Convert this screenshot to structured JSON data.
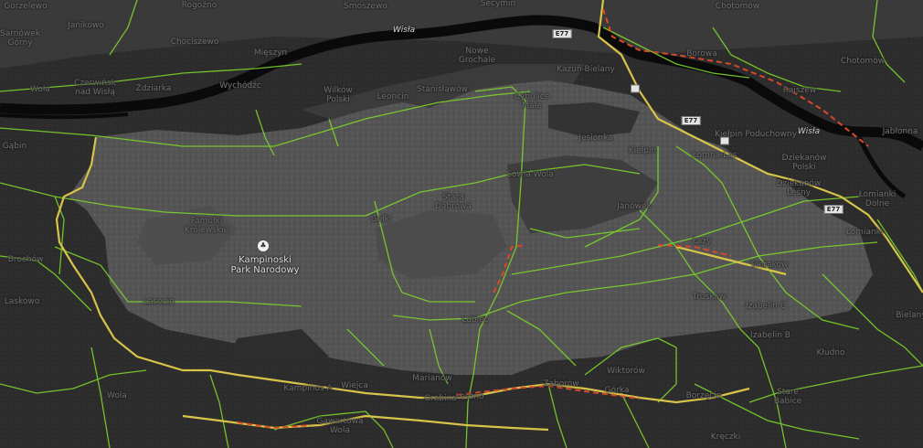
{
  "map": {
    "colors": {
      "background": "#2e2e2e",
      "forest": "#555555",
      "river": "#0b0b0b",
      "road_green": "#7bd32a",
      "road_yellow": "#d8c34a",
      "road_red": "#d9472b"
    },
    "park": {
      "name_line1": "Kampinoski",
      "name_line2": "Park Narodowy",
      "icon": "tree-icon"
    },
    "rivers": [
      "Wisła",
      "Wisła"
    ],
    "highways": [
      "E77",
      "E77",
      "E77",
      "E77"
    ],
    "places": [
      "Gorzelewo",
      "Janikowo",
      "Rogoźno",
      "Smoszewo",
      "Secymin",
      "Kazuń Polski",
      "Nowy Dwór Mazowiecki",
      "Piekiełko",
      "Sarnówek Górny",
      "Chociszewo",
      "Mięszyn",
      "Nowe Grochale",
      "Kazuń-Bielany",
      "Borowa",
      "Chotomów",
      "Wola",
      "Czerwińsk nad Wisłą",
      "Zdziarka",
      "Wychódźc",
      "Wilków Polski",
      "Leoncin",
      "Stanisławów",
      "Cybulice Małe",
      "Rajszew",
      "Jabłonna",
      "Gąbin",
      "Sowia Wola",
      "Jesionka",
      "Kiełpin",
      "Łomna-Las",
      "Kiełpin Poduchowny",
      "Dziekanów Polski",
      "Dziekanów Leśny",
      "Łomianki Dolne",
      "Famułki Królewskie",
      "Gołki",
      "Stara Dąbrowa",
      "Janówek",
      "Brochów",
      "Łazy",
      "Sierakow",
      "Łomianki",
      "Izabelin C",
      "Leszno",
      "Lubiec",
      "Truskaw",
      "Izabelin B",
      "Kłudno",
      "Laskowo",
      "Lasocin",
      "Marianów",
      "Wiktorów",
      "Stare Babice",
      "Zaborów",
      "Kampinos A",
      "Wiejca",
      "Grabina",
      "Leszno",
      "Górka",
      "Borzęcin",
      "Kręczki",
      "Gawartowa Wola",
      "Wola",
      "Bielany"
    ]
  }
}
